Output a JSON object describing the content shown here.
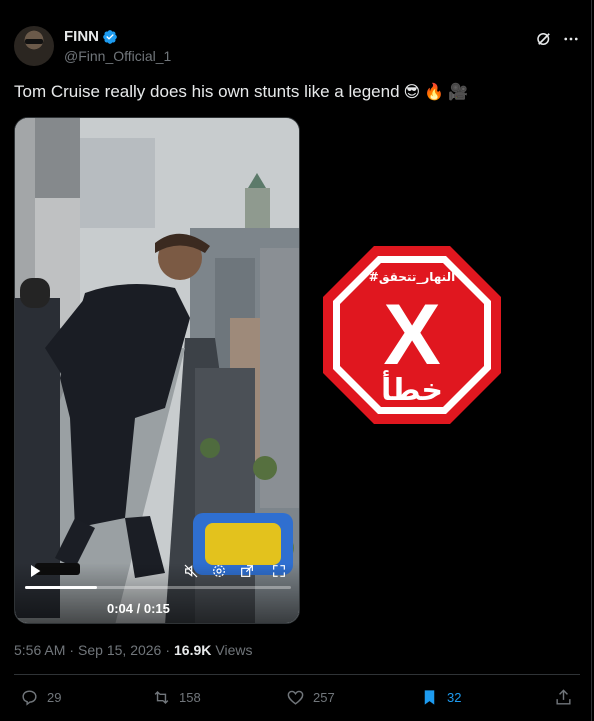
{
  "author": {
    "display_name": "FINN",
    "handle": "@Finn_Official_1",
    "verified": true
  },
  "tweet": {
    "text": "Tom Cruise really does his own stunts like a legend",
    "emojis": [
      "😎",
      "🔥",
      "🎥"
    ]
  },
  "video": {
    "current_time": "0:04",
    "duration": "0:15",
    "time_display": "0:04 / 0:15",
    "progress_fraction": 0.27,
    "muted": true
  },
  "fact_check_badge": {
    "hashtag_label": "#النهار_تتحقق",
    "mark": "X",
    "verdict": "خطأ",
    "color": "#e0171f"
  },
  "meta": {
    "time": "5:56 AM",
    "separator": "·",
    "date": "Sep 15, 2026",
    "views_count": "16.9K",
    "views_label": "Views"
  },
  "actions": {
    "replies": "29",
    "reposts": "158",
    "likes": "257",
    "bookmarks": "32"
  },
  "colors": {
    "background": "#000000",
    "text": "#e7e9ea",
    "muted": "#71767b",
    "accent": "#1d9bf0",
    "divider": "#2f3336"
  },
  "icons": {
    "verified": "verified-badge-icon",
    "grok": "grok-icon",
    "more": "more-icon",
    "reply": "reply-icon",
    "repost": "repost-icon",
    "like": "heart-icon",
    "bookmark": "bookmark-icon",
    "share": "share-icon",
    "play": "play-icon",
    "mute": "mute-icon",
    "settings": "settings-icon",
    "popout": "popout-icon",
    "fullscreen": "fullscreen-icon"
  }
}
